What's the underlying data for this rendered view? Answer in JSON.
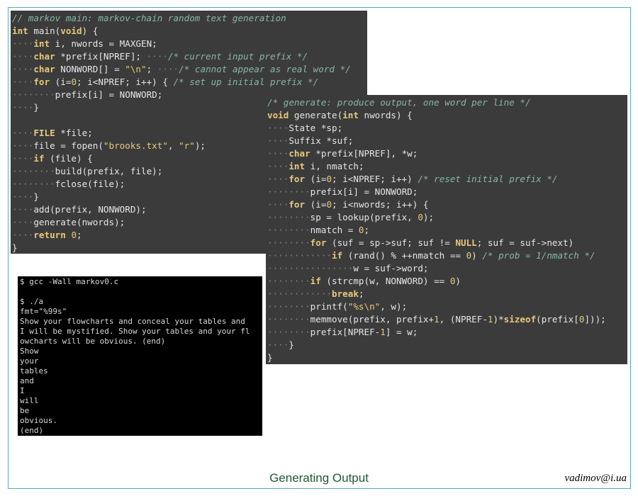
{
  "slide": {
    "title": "Generating Output",
    "author": "vadimov@i.ua"
  },
  "code_main": {
    "lines": [
      [
        [
          "cm",
          "// markov main: markov-chain random text generation"
        ]
      ],
      [
        [
          "kw",
          "int"
        ],
        [
          "t",
          " main("
        ],
        [
          "kw",
          "void"
        ],
        [
          "t",
          ") {"
        ]
      ],
      [
        [
          "ws",
          "····"
        ],
        [
          "kw",
          "int"
        ],
        [
          "t",
          " i, nwords = MAXGEN;"
        ]
      ],
      [
        [
          "ws",
          "····"
        ],
        [
          "kw",
          "char"
        ],
        [
          "t",
          " *prefix[NPREF]; "
        ],
        [
          "ws",
          "····"
        ],
        [
          "cm",
          "/* current input prefix */"
        ]
      ],
      [
        [
          "ws",
          "····"
        ],
        [
          "kw",
          "char"
        ],
        [
          "t",
          " NONWORD[] = "
        ],
        [
          "st",
          "\"\\n\""
        ],
        [
          "t",
          "; "
        ],
        [
          "ws",
          "····"
        ],
        [
          "cm",
          "/* cannot appear as real word */"
        ]
      ],
      [
        [
          "ws",
          "····"
        ],
        [
          "kw",
          "for"
        ],
        [
          "t",
          " (i="
        ],
        [
          "nu",
          "0"
        ],
        [
          "t",
          "; i<NPREF; i++) { "
        ],
        [
          "cm",
          "/* set up initial prefix */"
        ]
      ],
      [
        [
          "ws",
          "········"
        ],
        [
          "t",
          "prefix[i] = NONWORD;"
        ]
      ],
      [
        [
          "ws",
          "····"
        ],
        [
          "t",
          "}"
        ]
      ],
      [
        [
          "t",
          ""
        ]
      ],
      [
        [
          "ws",
          "····"
        ],
        [
          "kw",
          "FILE"
        ],
        [
          "t",
          " *file;"
        ]
      ],
      [
        [
          "ws",
          "····"
        ],
        [
          "t",
          "file = fopen("
        ],
        [
          "st",
          "\"brooks.txt\""
        ],
        [
          "t",
          ", "
        ],
        [
          "st",
          "\"r\""
        ],
        [
          "t",
          ");"
        ]
      ],
      [
        [
          "ws",
          "····"
        ],
        [
          "kw",
          "if"
        ],
        [
          "t",
          " (file) {"
        ]
      ],
      [
        [
          "ws",
          "········"
        ],
        [
          "t",
          "build(prefix, file);"
        ]
      ],
      [
        [
          "ws",
          "········"
        ],
        [
          "t",
          "fclose(file);"
        ]
      ],
      [
        [
          "ws",
          "····"
        ],
        [
          "t",
          "}"
        ]
      ],
      [
        [
          "ws",
          "····"
        ],
        [
          "t",
          "add(prefix, NONWORD);"
        ]
      ],
      [
        [
          "ws",
          "····"
        ],
        [
          "t",
          "generate(nwords);"
        ]
      ],
      [
        [
          "ws",
          "····"
        ],
        [
          "kw",
          "return"
        ],
        [
          "t",
          " "
        ],
        [
          "nu",
          "0"
        ],
        [
          "t",
          ";"
        ]
      ],
      [
        [
          "t",
          "}"
        ]
      ]
    ]
  },
  "code_generate": {
    "lines": [
      [
        [
          "cm",
          "/* generate: produce output, one word per line */"
        ]
      ],
      [
        [
          "kw",
          "void"
        ],
        [
          "t",
          " generate("
        ],
        [
          "kw",
          "int"
        ],
        [
          "t",
          " nwords) {"
        ]
      ],
      [
        [
          "ws",
          "····"
        ],
        [
          "t",
          "State *sp;"
        ]
      ],
      [
        [
          "ws",
          "····"
        ],
        [
          "t",
          "Suffix *suf;"
        ]
      ],
      [
        [
          "ws",
          "····"
        ],
        [
          "kw",
          "char"
        ],
        [
          "t",
          " *prefix[NPREF], *w;"
        ]
      ],
      [
        [
          "ws",
          "····"
        ],
        [
          "kw",
          "int"
        ],
        [
          "t",
          " i, nmatch;"
        ]
      ],
      [
        [
          "ws",
          "····"
        ],
        [
          "kw",
          "for"
        ],
        [
          "t",
          " (i="
        ],
        [
          "nu",
          "0"
        ],
        [
          "t",
          "; i<NPREF; i++) "
        ],
        [
          "cm",
          "/* reset initial prefix */"
        ]
      ],
      [
        [
          "ws",
          "········"
        ],
        [
          "t",
          "prefix[i] = NONWORD;"
        ]
      ],
      [
        [
          "ws",
          "····"
        ],
        [
          "kw",
          "for"
        ],
        [
          "t",
          " (i="
        ],
        [
          "nu",
          "0"
        ],
        [
          "t",
          "; i<nwords; i++) {"
        ]
      ],
      [
        [
          "ws",
          "········"
        ],
        [
          "t",
          "sp = lookup(prefix, "
        ],
        [
          "nu",
          "0"
        ],
        [
          "t",
          ");"
        ]
      ],
      [
        [
          "ws",
          "········"
        ],
        [
          "t",
          "nmatch = "
        ],
        [
          "nu",
          "0"
        ],
        [
          "t",
          ";"
        ]
      ],
      [
        [
          "ws",
          "········"
        ],
        [
          "kw",
          "for"
        ],
        [
          "t",
          " (suf = sp->suf; suf != "
        ],
        [
          "kw",
          "NULL"
        ],
        [
          "t",
          "; suf = suf->next)"
        ]
      ],
      [
        [
          "ws",
          "············"
        ],
        [
          "kw",
          "if"
        ],
        [
          "t",
          " (rand() % ++nmatch == "
        ],
        [
          "nu",
          "0"
        ],
        [
          "t",
          ") "
        ],
        [
          "cm",
          "/* prob = 1/nmatch */"
        ]
      ],
      [
        [
          "ws",
          "················"
        ],
        [
          "t",
          "w = suf->word;"
        ]
      ],
      [
        [
          "ws",
          "········"
        ],
        [
          "kw",
          "if"
        ],
        [
          "t",
          " (strcmp(w, NONWORD) == "
        ],
        [
          "nu",
          "0"
        ],
        [
          "t",
          ")"
        ]
      ],
      [
        [
          "ws",
          "············"
        ],
        [
          "kw",
          "break"
        ],
        [
          "t",
          ";"
        ]
      ],
      [
        [
          "ws",
          "········"
        ],
        [
          "t",
          "printf("
        ],
        [
          "st",
          "\"%s\\n\""
        ],
        [
          "t",
          ", w);"
        ]
      ],
      [
        [
          "ws",
          "········"
        ],
        [
          "t",
          "memmove(prefix, prefix+"
        ],
        [
          "nu",
          "1"
        ],
        [
          "t",
          ", (NPREF-"
        ],
        [
          "nu",
          "1"
        ],
        [
          "t",
          ")*"
        ],
        [
          "kw",
          "sizeof"
        ],
        [
          "t",
          "(prefix["
        ],
        [
          "nu",
          "0"
        ],
        [
          "t",
          "]));"
        ]
      ],
      [
        [
          "ws",
          "········"
        ],
        [
          "t",
          "prefix[NPREF-"
        ],
        [
          "nu",
          "1"
        ],
        [
          "t",
          "] = w;"
        ]
      ],
      [
        [
          "ws",
          "····"
        ],
        [
          "t",
          "}"
        ]
      ],
      [
        [
          "t",
          "}"
        ]
      ]
    ]
  },
  "terminal": {
    "lines": [
      "$ gcc -Wall markov0.c",
      "",
      "$ ./a",
      "fmt=\"%99s\"",
      "Show your flowcharts and conceal your tables and",
      "I will be mystified. Show your tables and your fl",
      "owcharts will be obvious. (end)",
      "Show",
      "your",
      "tables",
      "and",
      "I",
      "will",
      "be",
      "obvious.",
      "(end)"
    ]
  }
}
